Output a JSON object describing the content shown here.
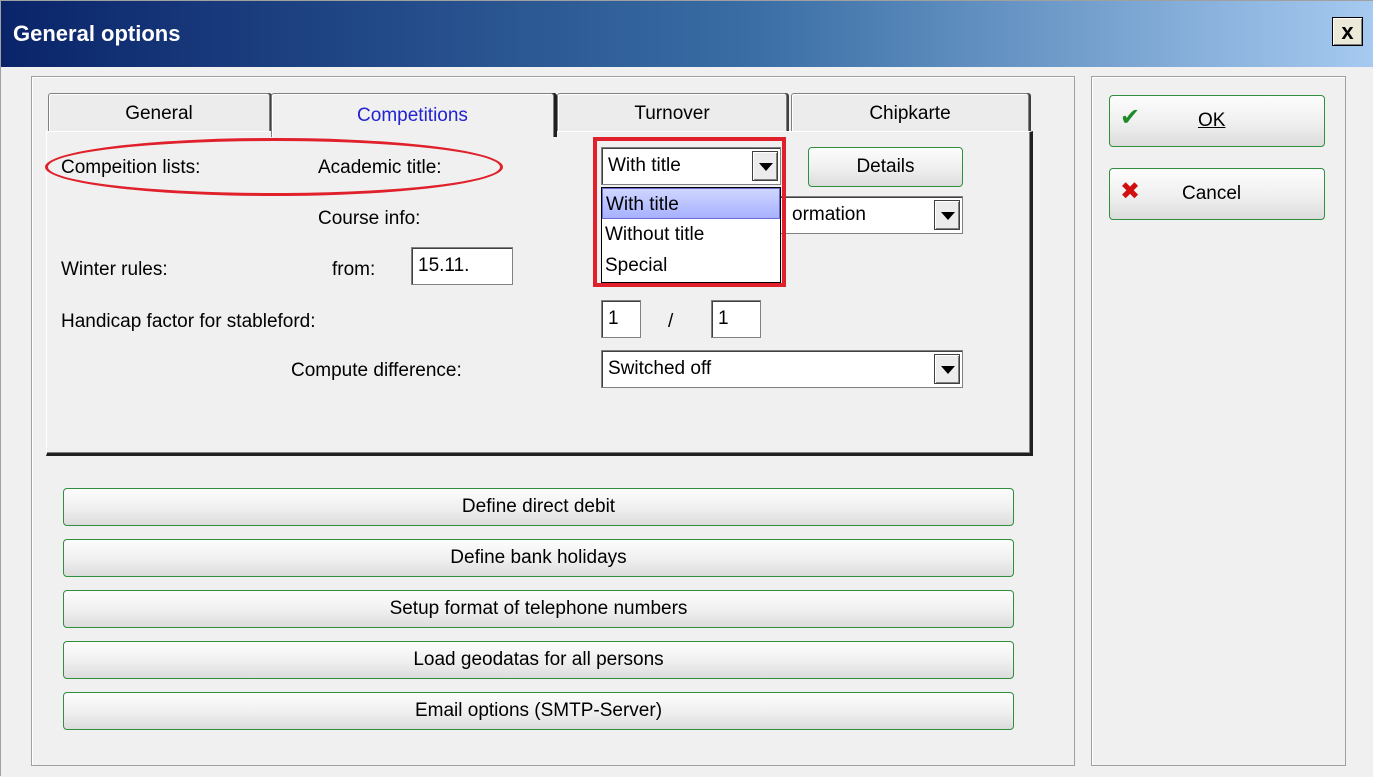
{
  "window": {
    "title": "General options",
    "close_label": "x"
  },
  "tabs": [
    {
      "label": "General"
    },
    {
      "label": "Competitions"
    },
    {
      "label": "Turnover"
    },
    {
      "label": "Chipkarte"
    }
  ],
  "competitions": {
    "competition_lists_label": "Compeition lists:",
    "academic_title_label": "Academic title:",
    "academic_title_value": "With title",
    "details_button": "Details",
    "course_info_label": "Course info:",
    "course_info_value": "ormation",
    "winter_rules_label": "Winter rules:",
    "from_label": "from:",
    "from_value": "15.11.",
    "handicap_label": "Handicap factor for stableford:",
    "handicap_value_1": "1",
    "handicap_separator": "/",
    "handicap_value_2": "1",
    "compute_difference_label": "Compute difference:",
    "compute_difference_value": "Switched off"
  },
  "dropdown": {
    "options": [
      "With title",
      "Without title",
      "Special"
    ],
    "selected": "With title"
  },
  "buttons": {
    "define_direct_debit": "Define direct debit",
    "define_bank_holidays": "Define bank holidays",
    "setup_telephone": "Setup format of telephone numbers",
    "load_geodatas": "Load geodatas for all persons",
    "email_options": "Email options (SMTP-Server)",
    "ok": "OK",
    "cancel": "Cancel"
  },
  "colors": {
    "highlight_red": "#e0202a",
    "active_tab_text": "#2323d0",
    "button_border_green": "#2f8f3f",
    "check_green": "#1e8a2a",
    "cross_red": "#d01010"
  },
  "icons": {
    "ok": "checkmark-icon",
    "cancel": "cross-icon"
  }
}
